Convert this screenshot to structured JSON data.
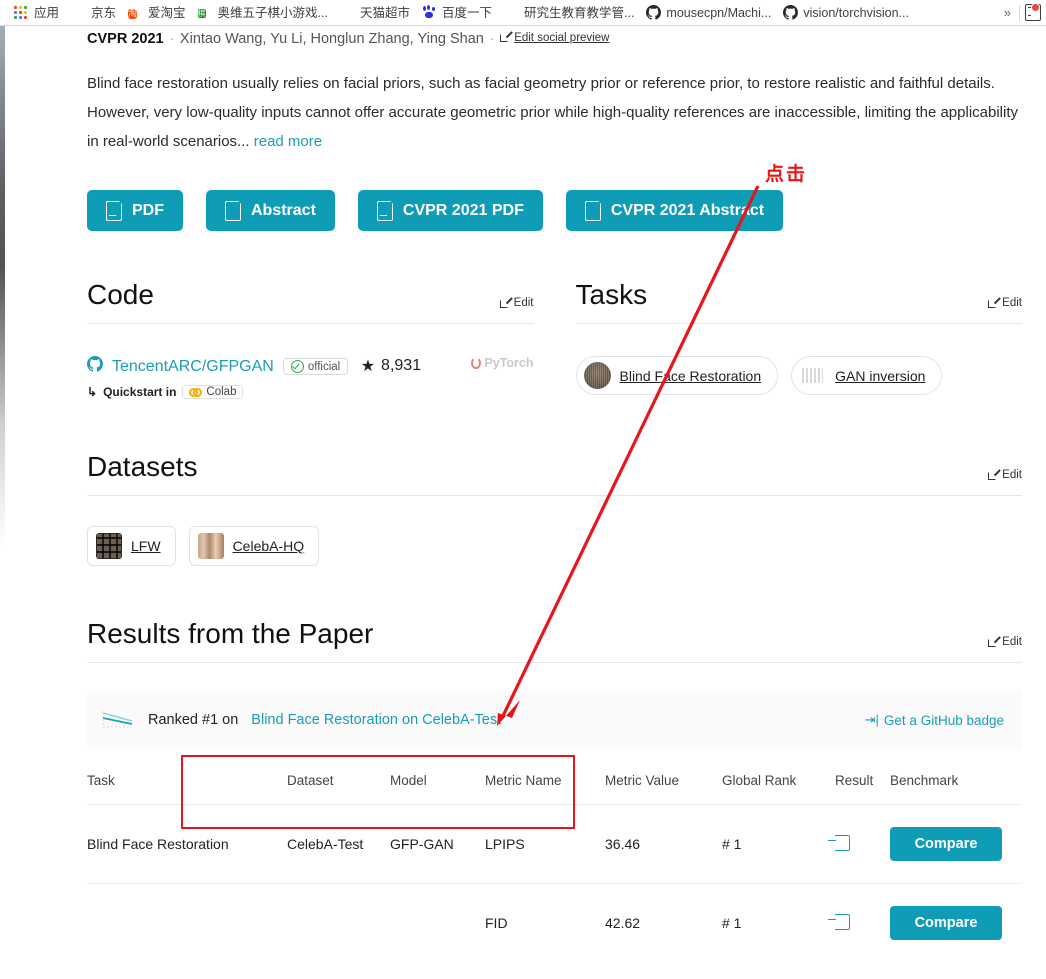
{
  "browser": {
    "bookmarks": [
      {
        "label": "应用",
        "icon": "apps-grid-icon"
      },
      {
        "label": "京东",
        "icon": "globe-icon"
      },
      {
        "label": "爱淘宝",
        "icon": "taobao-icon"
      },
      {
        "label": "奥维五子棋小游戏...",
        "icon": "green-app-icon"
      },
      {
        "label": "天猫超市",
        "icon": "globe-icon"
      },
      {
        "label": "百度一下",
        "icon": "baidu-paw-icon"
      },
      {
        "label": "研究生教育教学管...",
        "icon": "globe-icon"
      },
      {
        "label": "mousecpn/Machi...",
        "icon": "github-icon"
      },
      {
        "label": "vision/torchvision...",
        "icon": "github-icon"
      }
    ],
    "overflow_label": "»",
    "extension_name": "extension-icon"
  },
  "paper": {
    "venue": "CVPR 2021",
    "separator": "·",
    "authors": "Xintao Wang, Yu Li, Honglun Zhang, Ying Shan",
    "edit_social_preview": "Edit social preview",
    "abstract": "Blind face restoration usually relies on facial priors, such as facial geometry prior or reference prior, to restore realistic and faithful details. However, very low-quality inputs cannot offer accurate geometric prior while high-quality references are inaccessible, limiting the applicability in real-world scenarios...",
    "read_more": "read more",
    "buttons": [
      {
        "label": "PDF",
        "icon": "pdf-file-icon"
      },
      {
        "label": "Abstract",
        "icon": "file-icon"
      },
      {
        "label": "CVPR 2021 PDF",
        "icon": "pdf-file-icon"
      },
      {
        "label": "CVPR 2021 Abstract",
        "icon": "file-icon"
      }
    ]
  },
  "code": {
    "title": "Code",
    "edit_label": "Edit",
    "repo_name": "TencentARC/GFPGAN",
    "official_badge": "official",
    "quickstart_label": "Quickstart in",
    "colab_label": "Colab",
    "stars": "8,931",
    "star_glyph": "★",
    "framework": "PyTorch"
  },
  "tasks": {
    "title": "Tasks",
    "edit_label": "Edit",
    "items": [
      {
        "label": "Blind Face Restoration",
        "thumb": "face-thumbnail"
      },
      {
        "label": "GAN inversion",
        "thumb": "bars-thumbnail"
      }
    ]
  },
  "datasets": {
    "title": "Datasets",
    "edit_label": "Edit",
    "items": [
      {
        "label": "LFW",
        "thumb": "lfw-thumbnail"
      },
      {
        "label": "CelebA-HQ",
        "thumb": "celeba-thumbnail"
      }
    ]
  },
  "results": {
    "title": "Results from the Paper",
    "edit_label": "Edit",
    "rank_prefix": "Ranked #1 on",
    "rank_link": "Blind Face Restoration on CelebA-Test",
    "github_badge": "Get a GitHub badge",
    "columns": [
      "Task",
      "Dataset",
      "Model",
      "Metric Name",
      "Metric Value",
      "Global Rank",
      "Result",
      "Benchmark"
    ],
    "rows": [
      {
        "task": "Blind Face Restoration",
        "dataset": "CelebA-Test",
        "model": "GFP-GAN",
        "metric_name": "LPIPS",
        "metric_value": "36.46",
        "global_rank": "# 1",
        "result_icon": "enter-arrow-icon",
        "benchmark": "Compare"
      },
      {
        "task": "",
        "dataset": "",
        "model": "",
        "metric_name": "FID",
        "metric_value": "42.62",
        "global_rank": "# 1",
        "result_icon": "enter-arrow-icon",
        "benchmark": "Compare"
      }
    ]
  },
  "annotation": {
    "click_text": "点击",
    "color": "#e8151b"
  }
}
